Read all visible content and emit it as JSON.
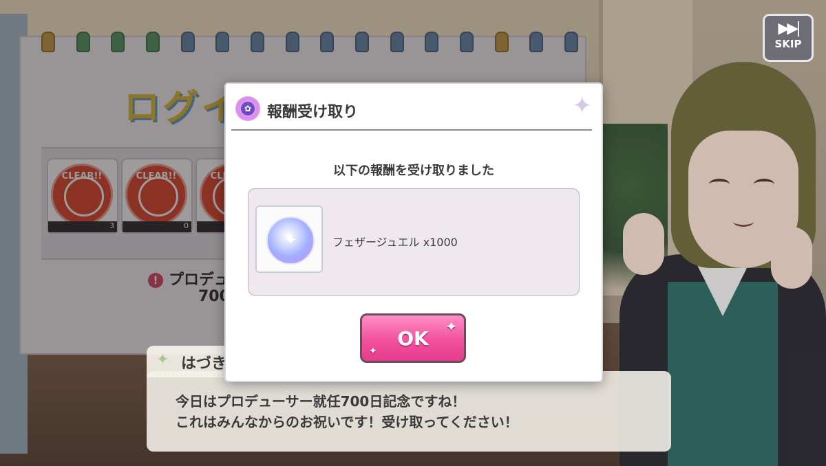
{
  "skip": {
    "label": "SKIP",
    "icon": "fast-forward-icon"
  },
  "board": {
    "title": "ログイ",
    "stamps": [
      {
        "text": "CLEAR!!",
        "count": "3"
      },
      {
        "text": "CLEAR!!",
        "count": "0"
      },
      {
        "text": "CLEAR!!",
        "count": ""
      }
    ],
    "note": "プロデュー",
    "note_number": "700"
  },
  "modal": {
    "title": "報酬受け取り",
    "message": "以下の報酬を受け取りました",
    "reward": {
      "name": "フェザージュエル x1000",
      "icon": "feather-jewel-icon"
    },
    "ok_label": "OK"
  },
  "dialogue": {
    "speaker": "はづき",
    "line1": "今日はプロデューサー就任700日記念ですね！",
    "line2": "これはみんなからのお祝いです！受け取ってください！"
  },
  "colors": {
    "ok_button": "#f2509e",
    "modal_border": "#d9d4dd",
    "accent_sparkle": "#a6c98a"
  }
}
